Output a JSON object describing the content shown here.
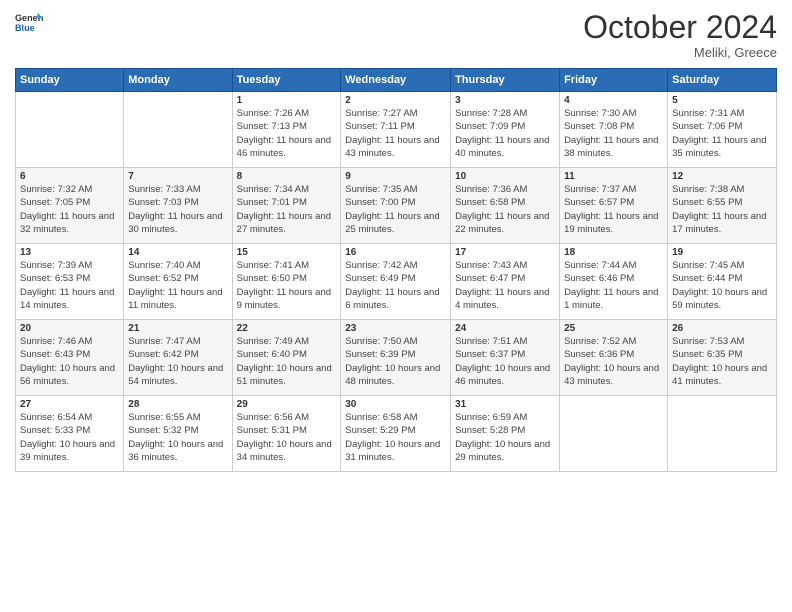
{
  "header": {
    "logo_line1": "General",
    "logo_line2": "Blue",
    "month": "October 2024",
    "location": "Meliki, Greece"
  },
  "weekdays": [
    "Sunday",
    "Monday",
    "Tuesday",
    "Wednesday",
    "Thursday",
    "Friday",
    "Saturday"
  ],
  "weeks": [
    [
      {
        "day": "",
        "info": ""
      },
      {
        "day": "",
        "info": ""
      },
      {
        "day": "1",
        "info": "Sunrise: 7:26 AM\nSunset: 7:13 PM\nDaylight: 11 hours and 46 minutes."
      },
      {
        "day": "2",
        "info": "Sunrise: 7:27 AM\nSunset: 7:11 PM\nDaylight: 11 hours and 43 minutes."
      },
      {
        "day": "3",
        "info": "Sunrise: 7:28 AM\nSunset: 7:09 PM\nDaylight: 11 hours and 40 minutes."
      },
      {
        "day": "4",
        "info": "Sunrise: 7:30 AM\nSunset: 7:08 PM\nDaylight: 11 hours and 38 minutes."
      },
      {
        "day": "5",
        "info": "Sunrise: 7:31 AM\nSunset: 7:06 PM\nDaylight: 11 hours and 35 minutes."
      }
    ],
    [
      {
        "day": "6",
        "info": "Sunrise: 7:32 AM\nSunset: 7:05 PM\nDaylight: 11 hours and 32 minutes."
      },
      {
        "day": "7",
        "info": "Sunrise: 7:33 AM\nSunset: 7:03 PM\nDaylight: 11 hours and 30 minutes."
      },
      {
        "day": "8",
        "info": "Sunrise: 7:34 AM\nSunset: 7:01 PM\nDaylight: 11 hours and 27 minutes."
      },
      {
        "day": "9",
        "info": "Sunrise: 7:35 AM\nSunset: 7:00 PM\nDaylight: 11 hours and 25 minutes."
      },
      {
        "day": "10",
        "info": "Sunrise: 7:36 AM\nSunset: 6:58 PM\nDaylight: 11 hours and 22 minutes."
      },
      {
        "day": "11",
        "info": "Sunrise: 7:37 AM\nSunset: 6:57 PM\nDaylight: 11 hours and 19 minutes."
      },
      {
        "day": "12",
        "info": "Sunrise: 7:38 AM\nSunset: 6:55 PM\nDaylight: 11 hours and 17 minutes."
      }
    ],
    [
      {
        "day": "13",
        "info": "Sunrise: 7:39 AM\nSunset: 6:53 PM\nDaylight: 11 hours and 14 minutes."
      },
      {
        "day": "14",
        "info": "Sunrise: 7:40 AM\nSunset: 6:52 PM\nDaylight: 11 hours and 11 minutes."
      },
      {
        "day": "15",
        "info": "Sunrise: 7:41 AM\nSunset: 6:50 PM\nDaylight: 11 hours and 9 minutes."
      },
      {
        "day": "16",
        "info": "Sunrise: 7:42 AM\nSunset: 6:49 PM\nDaylight: 11 hours and 6 minutes."
      },
      {
        "day": "17",
        "info": "Sunrise: 7:43 AM\nSunset: 6:47 PM\nDaylight: 11 hours and 4 minutes."
      },
      {
        "day": "18",
        "info": "Sunrise: 7:44 AM\nSunset: 6:46 PM\nDaylight: 11 hours and 1 minute."
      },
      {
        "day": "19",
        "info": "Sunrise: 7:45 AM\nSunset: 6:44 PM\nDaylight: 10 hours and 59 minutes."
      }
    ],
    [
      {
        "day": "20",
        "info": "Sunrise: 7:46 AM\nSunset: 6:43 PM\nDaylight: 10 hours and 56 minutes."
      },
      {
        "day": "21",
        "info": "Sunrise: 7:47 AM\nSunset: 6:42 PM\nDaylight: 10 hours and 54 minutes."
      },
      {
        "day": "22",
        "info": "Sunrise: 7:49 AM\nSunset: 6:40 PM\nDaylight: 10 hours and 51 minutes."
      },
      {
        "day": "23",
        "info": "Sunrise: 7:50 AM\nSunset: 6:39 PM\nDaylight: 10 hours and 48 minutes."
      },
      {
        "day": "24",
        "info": "Sunrise: 7:51 AM\nSunset: 6:37 PM\nDaylight: 10 hours and 46 minutes."
      },
      {
        "day": "25",
        "info": "Sunrise: 7:52 AM\nSunset: 6:36 PM\nDaylight: 10 hours and 43 minutes."
      },
      {
        "day": "26",
        "info": "Sunrise: 7:53 AM\nSunset: 6:35 PM\nDaylight: 10 hours and 41 minutes."
      }
    ],
    [
      {
        "day": "27",
        "info": "Sunrise: 6:54 AM\nSunset: 5:33 PM\nDaylight: 10 hours and 39 minutes."
      },
      {
        "day": "28",
        "info": "Sunrise: 6:55 AM\nSunset: 5:32 PM\nDaylight: 10 hours and 36 minutes."
      },
      {
        "day": "29",
        "info": "Sunrise: 6:56 AM\nSunset: 5:31 PM\nDaylight: 10 hours and 34 minutes."
      },
      {
        "day": "30",
        "info": "Sunrise: 6:58 AM\nSunset: 5:29 PM\nDaylight: 10 hours and 31 minutes."
      },
      {
        "day": "31",
        "info": "Sunrise: 6:59 AM\nSunset: 5:28 PM\nDaylight: 10 hours and 29 minutes."
      },
      {
        "day": "",
        "info": ""
      },
      {
        "day": "",
        "info": ""
      }
    ]
  ]
}
